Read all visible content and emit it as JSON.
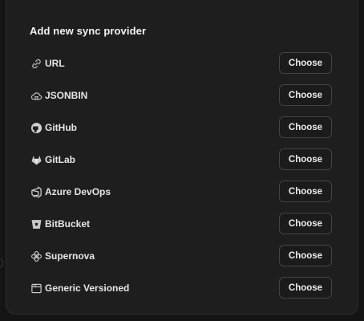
{
  "dialog": {
    "title": "Add new sync provider",
    "button_label": "Choose",
    "providers": [
      {
        "label": "URL",
        "icon": "link-icon"
      },
      {
        "label": "JSONBIN",
        "icon": "cloud-bin-icon"
      },
      {
        "label": "GitHub",
        "icon": "github-icon"
      },
      {
        "label": "GitLab",
        "icon": "gitlab-icon"
      },
      {
        "label": "Azure DevOps",
        "icon": "azure-devops-icon"
      },
      {
        "label": "BitBucket",
        "icon": "bitbucket-icon"
      },
      {
        "label": "Supernova",
        "icon": "supernova-icon"
      },
      {
        "label": "Generic Versioned",
        "icon": "generic-versioned-icon"
      }
    ]
  }
}
